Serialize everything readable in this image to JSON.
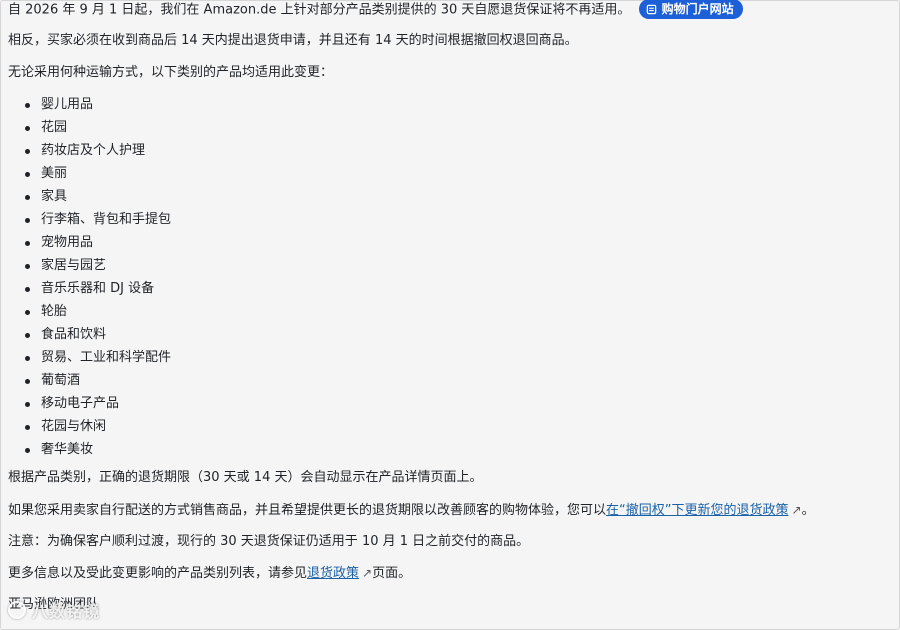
{
  "intro": {
    "text": "自 2026 年 9 月 1 日起，我们在 Amazon.de 上针对部分产品类别提供的 30 天自愿退货保证将不再适用。",
    "pill_label": "购物门户网站"
  },
  "para1": "相反，买家必须在收到商品后 14 天内提出退货申请，并且还有 14 天的时间根据撤回权退回商品。",
  "para2": "无论采用何种运输方式，以下类别的产品均适用此变更：",
  "categories": [
    "婴儿用品",
    "花园",
    "药妆店及个人护理",
    "美丽",
    "家具",
    "行李箱、背包和手提包",
    "宠物用品",
    "家居与园艺",
    "音乐乐器和 DJ 设备",
    "轮胎",
    "食品和饮料",
    "贸易、工业和科学配件",
    "葡萄酒",
    "移动电子产品",
    "花园与休闲",
    "奢华美妆"
  ],
  "para3": "根据产品类别，正确的退货期限（30 天或 14 天）会自动显示在产品详情页面上。",
  "para4": {
    "before": "如果您采用卖家自行配送的方式销售商品，并且希望提供更长的退货期限以改善顾客的购物体验，您可以",
    "link": "在“撤回权”下更新您的退货政策",
    "after": "。"
  },
  "para5": "注意：为确保客户顺利过渡，现行的 30 天退货保证仍适用于 10 月 1 日之前交付的商品。",
  "para6": {
    "before": "更多信息以及受此变更影响的产品类别列表，请参见",
    "link": "退货政策",
    "after": "页面。"
  },
  "signature": "亚马逊欧洲团队",
  "watermark": "八数铭镜",
  "colors": {
    "pill_bg": "#1d5fd6",
    "link": "#1b61a8",
    "text": "#1f2328"
  },
  "icons": {
    "pill_icon": "store-icon",
    "external": "external-link-icon"
  }
}
